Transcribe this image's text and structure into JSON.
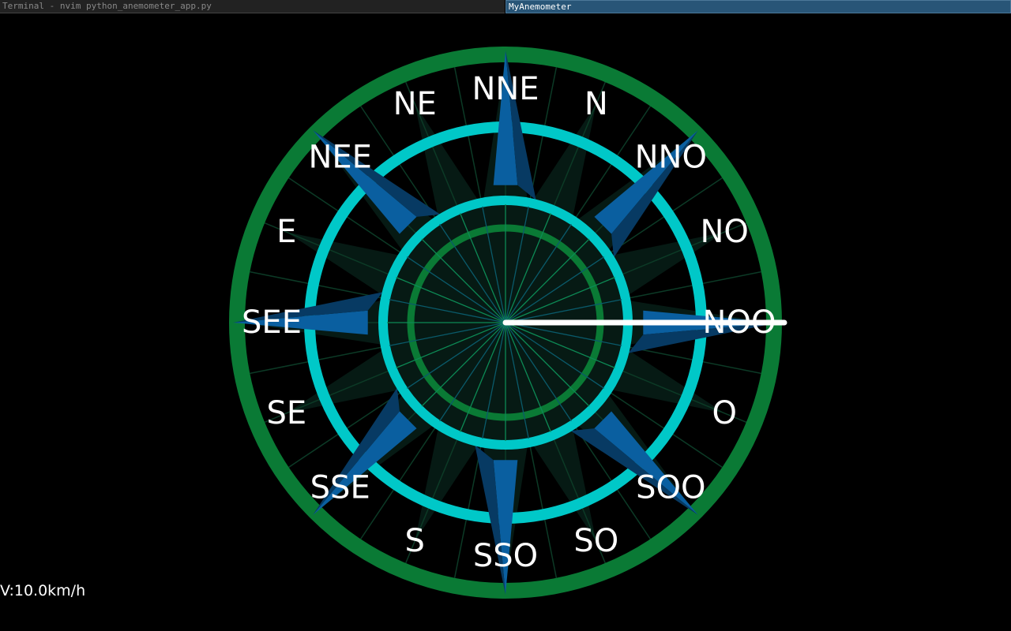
{
  "taskbar": {
    "windows": [
      {
        "title": "Terminal - nvim python_anemometer_app.py",
        "active": false
      },
      {
        "title": "MyAnemometer",
        "active": true
      }
    ]
  },
  "compass": {
    "labels": [
      "NNE",
      "N",
      "NNO",
      "NO",
      "NOO",
      "O",
      "SOO",
      "SO",
      "SSO",
      "S",
      "SSE",
      "SE",
      "SEE",
      "E",
      "NEE",
      "NE"
    ],
    "needle_direction": "NOO",
    "colors": {
      "outer_ring": "#0a7a35",
      "cyan_ring": "#00c8c8",
      "inner_ring": "#0a7a35",
      "star_blue": "#0a5fa0",
      "star_dark": "#061a14",
      "needle": "#ffffff",
      "text": "#ffffff"
    }
  },
  "status": {
    "speed_text": "V:10.0km/h"
  }
}
